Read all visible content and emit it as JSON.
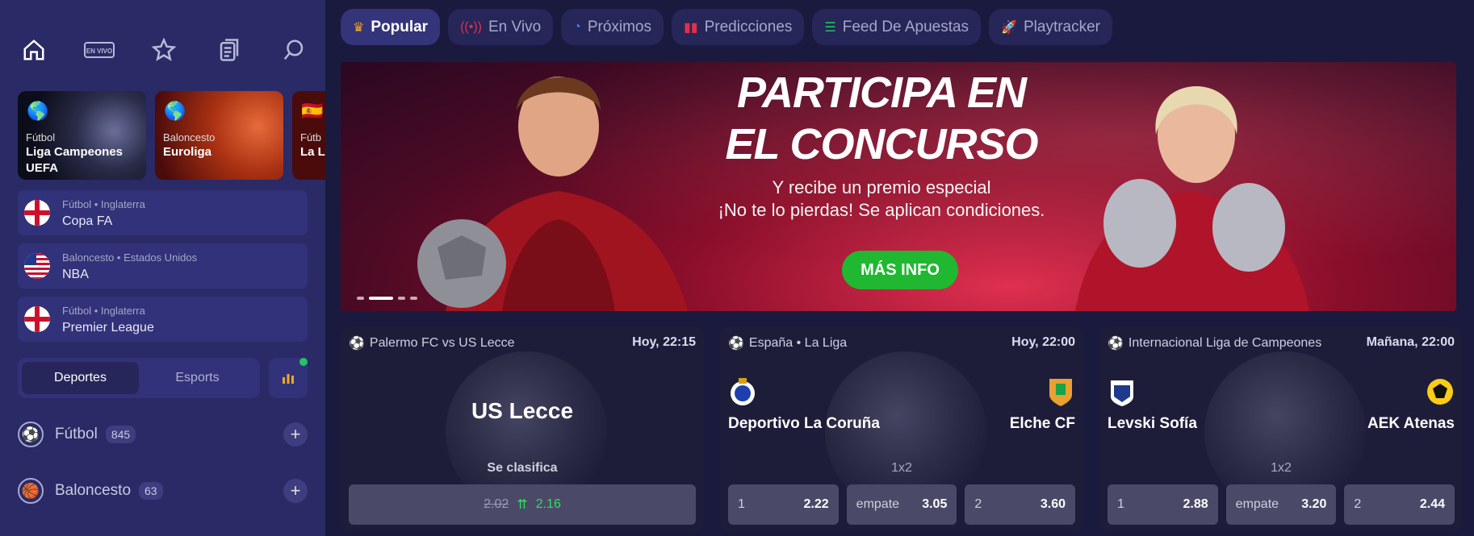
{
  "sidebar": {
    "icons": [
      "home-icon",
      "live-tv-icon",
      "star-icon",
      "betslip-icon",
      "search-icon"
    ],
    "live_label": "EN VIVO",
    "featured": [
      {
        "flag": "🌎",
        "sport": "Fútbol",
        "name1": "Liga Campeones",
        "name2": "UEFA"
      },
      {
        "flag": "🌎",
        "sport": "Baloncesto",
        "name1": "Euroliga",
        "name2": ""
      },
      {
        "flag": "🇪🇸",
        "sport": "Fútb",
        "name1": "La L",
        "name2": ""
      }
    ],
    "leagues": [
      {
        "meta": "Fútbol • Inglaterra",
        "name": "Copa FA",
        "flag": "england"
      },
      {
        "meta": "Baloncesto • Estados Unidos",
        "name": "NBA",
        "flag": "usa"
      },
      {
        "meta": "Fútbol • Inglaterra",
        "name": "Premier League",
        "flag": "england"
      }
    ],
    "toggle": {
      "sports": "Deportes",
      "esports": "Esports"
    },
    "sports": [
      {
        "name": "Fútbol",
        "count": "845"
      },
      {
        "name": "Baloncesto",
        "count": "63"
      }
    ]
  },
  "topnav": [
    {
      "label": "Popular",
      "icon": "crown-icon"
    },
    {
      "label": "En Vivo",
      "icon": "live-icon"
    },
    {
      "label": "Próximos",
      "icon": "clock-icon"
    },
    {
      "label": "Predicciones",
      "icon": "bars-icon"
    },
    {
      "label": "Feed De Apuestas",
      "icon": "list-icon"
    },
    {
      "label": "Playtracker",
      "icon": "rocket-icon"
    }
  ],
  "banner": {
    "title1": "PARTICIPA EN",
    "title2": "EL CONCURSO",
    "sub1": "Y recibe un premio especial",
    "sub2": "¡No te lo pierdas! Se aplican condiciones.",
    "cta": "MÁS INFO"
  },
  "matches": [
    {
      "title": "Palermo FC vs US Lecce",
      "time": "Hoy, 22:15",
      "team": "US Lecce",
      "market": "Se clasifica",
      "old_odd": "2.02",
      "new_odd": "2.16"
    },
    {
      "title": "España • La Liga",
      "time": "Hoy, 22:00",
      "home": "Deportivo La Coruña",
      "away": "Elche CF",
      "market": "1x2",
      "odds": [
        {
          "label": "1",
          "value": "2.22"
        },
        {
          "label": "empate",
          "value": "3.05"
        },
        {
          "label": "2",
          "value": "3.60"
        }
      ]
    },
    {
      "title": "Internacional Liga de Campeones",
      "time": "Mañana, 22:00",
      "home": "Levski Sofía",
      "away": "AEK Atenas",
      "market": "1x2",
      "odds": [
        {
          "label": "1",
          "value": "2.88"
        },
        {
          "label": "empate",
          "value": "3.20"
        },
        {
          "label": "2",
          "value": "2.44"
        }
      ]
    }
  ],
  "colors": {
    "accent_green": "#1fb830",
    "sidebar_bg": "#2a2a66",
    "page_bg": "#1a1a3e"
  }
}
